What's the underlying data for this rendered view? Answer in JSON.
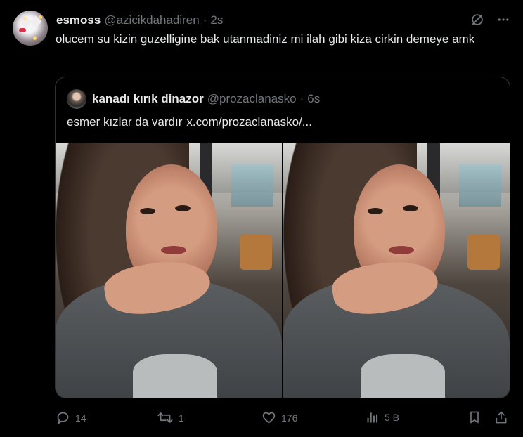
{
  "tweet": {
    "display_name": "esmoss",
    "handle": "@azicikdahadiren",
    "separator": "·",
    "time": "2s",
    "text": "olucem su kizin guzelligine bak utanmadiniz mi ilah gibi kiza cirkin demeye amk"
  },
  "quote": {
    "display_name": "kanadı kırık dinazor",
    "handle": "@prozaclanasko",
    "separator": "·",
    "time": "6s",
    "text": "esmer kızlar da vardır",
    "link": "x.com/prozaclanasko/..."
  },
  "actions": {
    "reply_count": "14",
    "retweet_count": "1",
    "like_count": "176",
    "views_count": "5 B"
  },
  "icons": {
    "grok": "grok-icon",
    "more": "more-icon",
    "reply": "reply-icon",
    "retweet": "retweet-icon",
    "like": "heart-icon",
    "views": "views-icon",
    "bookmark": "bookmark-icon",
    "share": "share-icon"
  },
  "colors": {
    "background": "#000000",
    "text": "#e7e9ea",
    "muted": "#71767b",
    "border": "#2f3336"
  }
}
